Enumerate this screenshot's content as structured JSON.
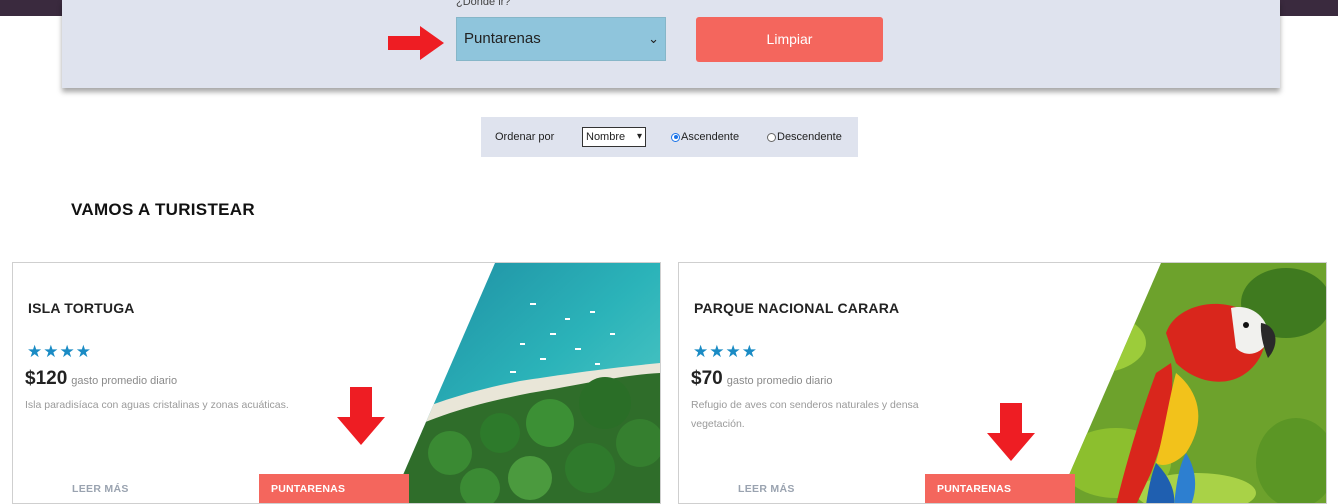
{
  "filter": {
    "where_label": "¿Donde ir?",
    "destination_selected": "Puntarenas",
    "clear_button": "Limpiar"
  },
  "sort": {
    "label": "Ordenar por",
    "selected": "Nombre",
    "options": [
      "Ascendente",
      "Descendente"
    ],
    "selected_option": "Ascendente"
  },
  "section_title": "VAMOS A TURISTEAR",
  "colors": {
    "accent": "#f4665d",
    "panel": "#dfe3ee",
    "select": "#8fc5dc",
    "stars": "#1a8bc4"
  },
  "cards": [
    {
      "title": "ISLA TORTUGA",
      "stars": "★★★★",
      "price": "$120",
      "price_note": "gasto promedio diario",
      "description": "Isla paradisíaca con aguas cristalinas y zonas acuáticas.",
      "read_more": "LEER MÁS",
      "region": "PUNTARENAS",
      "image": "aerial-beach-island-photo"
    },
    {
      "title": "PARQUE NACIONAL CARARA",
      "stars": "★★★★",
      "price": "$70",
      "price_note": "gasto promedio diario",
      "description": "Refugio de aves con senderos naturales y densa vegetación.",
      "read_more": "LEER MÁS",
      "region": "PUNTARENAS",
      "image": "scarlet-macaw-photo"
    }
  ]
}
